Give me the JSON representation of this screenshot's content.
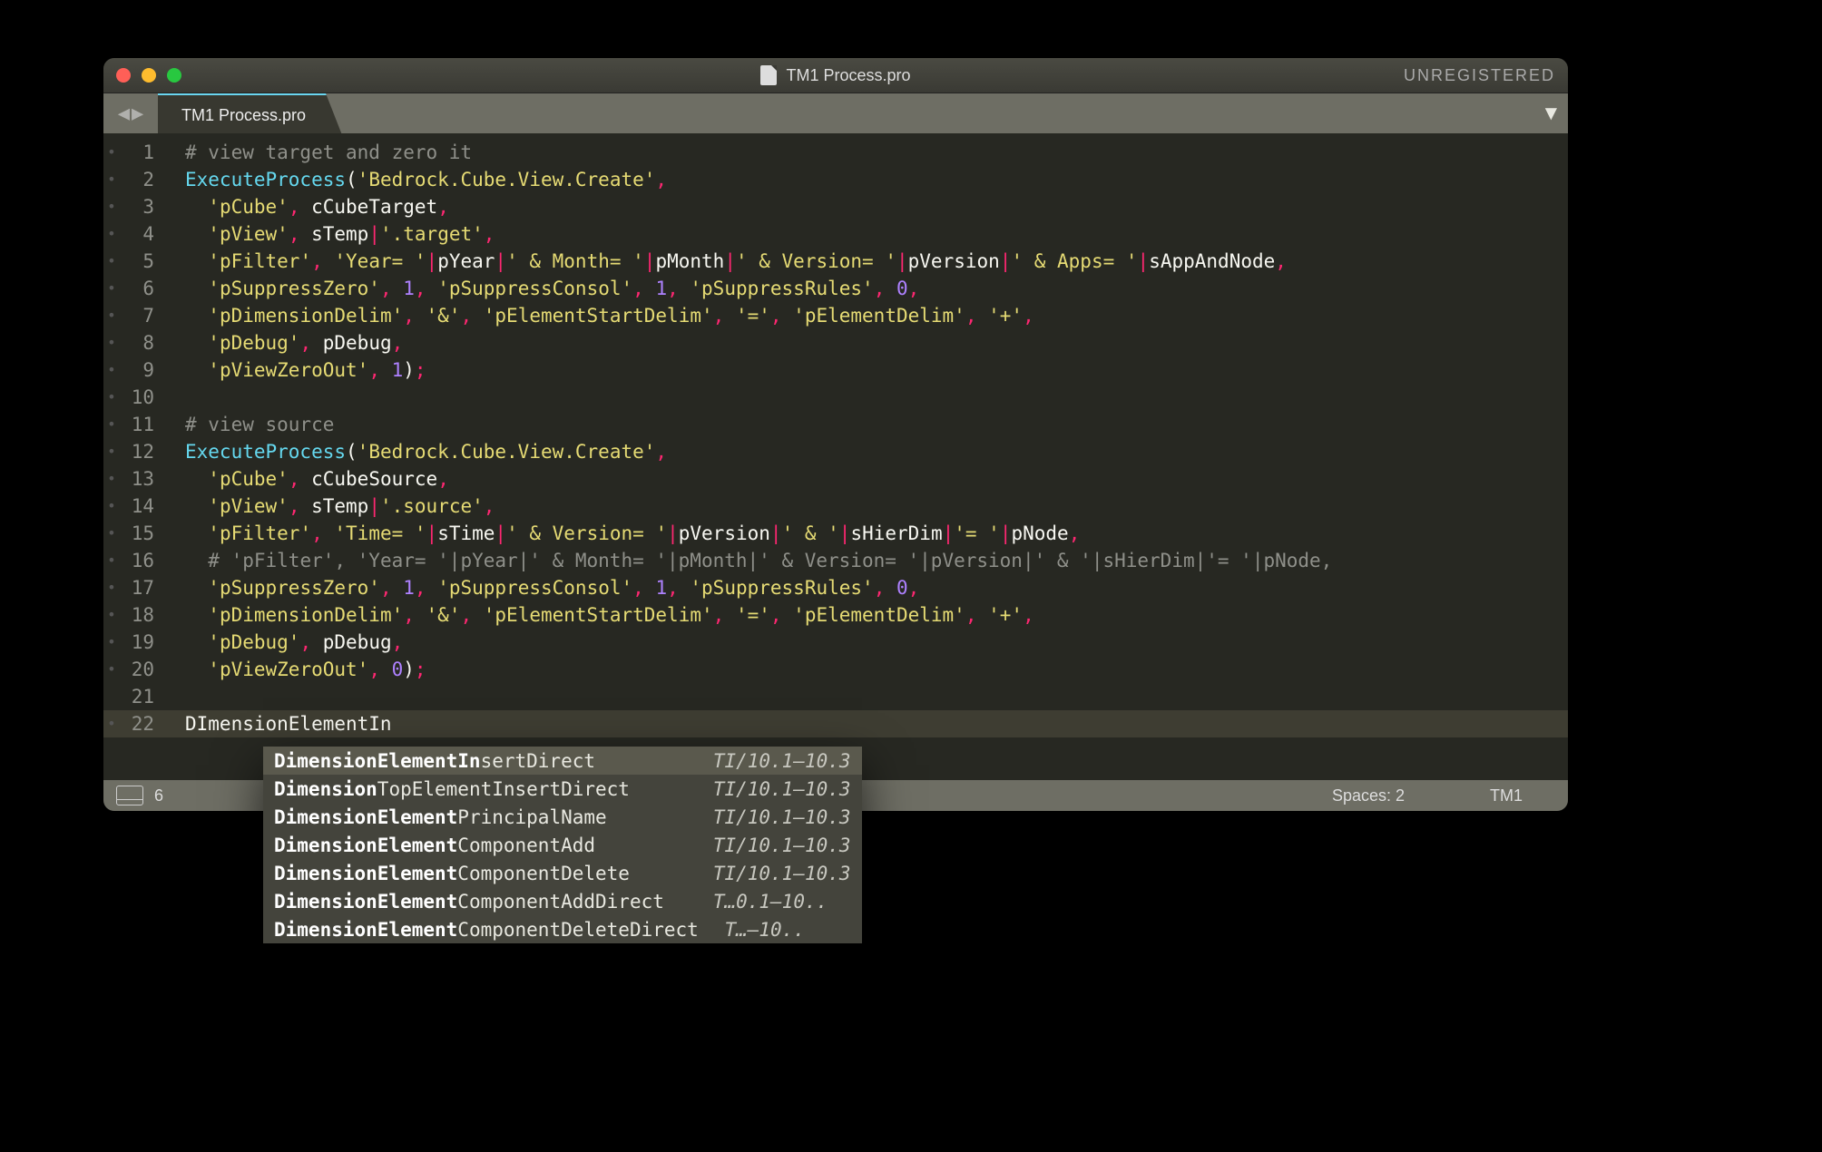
{
  "window": {
    "title": "TM1 Process.pro",
    "unregistered_label": "UNREGISTERED"
  },
  "tab": {
    "label": "TM1 Process.pro"
  },
  "status": {
    "spaces": "Spaces: 2",
    "lang": "TM1",
    "six": "6"
  },
  "autocomplete": {
    "typed": "DImensionElementIn",
    "items": [
      {
        "bold": "DimensionElementIn",
        "rest": "sertDirect",
        "cat": "TI/10.1–10.3"
      },
      {
        "bold": "Dimension",
        "rest": "TopElementInsertDirect",
        "cat": "TI/10.1–10.3"
      },
      {
        "bold": "DimensionElement",
        "rest": "PrincipalName",
        "cat": "TI/10.1–10.3"
      },
      {
        "bold": "DimensionElement",
        "rest": "ComponentAdd",
        "cat": "TI/10.1–10.3"
      },
      {
        "bold": "DimensionElement",
        "rest": "ComponentDelete",
        "cat": "TI/10.1–10.3"
      },
      {
        "bold": "DimensionElement",
        "rest": "ComponentAddDirect",
        "cat": "T…0.1–10.."
      },
      {
        "bold": "DimensionElement",
        "rest": "ComponentDeleteDirect",
        "cat": "T…–10.."
      }
    ]
  },
  "code": {
    "lines": [
      {
        "n": 1,
        "dot": true,
        "tokens": [
          [
            "comment",
            "# view target and zero it"
          ]
        ]
      },
      {
        "n": 2,
        "dot": true,
        "tokens": [
          [
            "func",
            "ExecuteProcess"
          ],
          [
            "plain",
            "("
          ],
          [
            "string",
            "'Bedrock.Cube.View.Create'"
          ],
          [
            "punc",
            ","
          ]
        ]
      },
      {
        "n": 3,
        "dot": true,
        "tokens": [
          [
            "plain",
            "  "
          ],
          [
            "string",
            "'pCube'"
          ],
          [
            "punc",
            ", "
          ],
          [
            "var",
            "cCubeTarget"
          ],
          [
            "punc",
            ","
          ]
        ]
      },
      {
        "n": 4,
        "dot": true,
        "tokens": [
          [
            "plain",
            "  "
          ],
          [
            "string",
            "'pView'"
          ],
          [
            "punc",
            ", "
          ],
          [
            "var",
            "sTemp"
          ],
          [
            "op",
            "|"
          ],
          [
            "string",
            "'.target'"
          ],
          [
            "punc",
            ","
          ]
        ]
      },
      {
        "n": 5,
        "dot": true,
        "tokens": [
          [
            "plain",
            "  "
          ],
          [
            "string",
            "'pFilter'"
          ],
          [
            "punc",
            ", "
          ],
          [
            "string",
            "'Year= '"
          ],
          [
            "op",
            "|"
          ],
          [
            "var",
            "pYear"
          ],
          [
            "op",
            "|"
          ],
          [
            "string",
            "' & Month= '"
          ],
          [
            "op",
            "|"
          ],
          [
            "var",
            "pMonth"
          ],
          [
            "op",
            "|"
          ],
          [
            "string",
            "' & Version= '"
          ],
          [
            "op",
            "|"
          ],
          [
            "var",
            "pVersion"
          ],
          [
            "op",
            "|"
          ],
          [
            "string",
            "' & Apps= '"
          ],
          [
            "op",
            "|"
          ],
          [
            "var",
            "sAppAndNode"
          ],
          [
            "punc",
            ","
          ]
        ]
      },
      {
        "n": 6,
        "dot": true,
        "tokens": [
          [
            "plain",
            "  "
          ],
          [
            "string",
            "'pSuppressZero'"
          ],
          [
            "punc",
            ", "
          ],
          [
            "num",
            "1"
          ],
          [
            "punc",
            ", "
          ],
          [
            "string",
            "'pSuppressConsol'"
          ],
          [
            "punc",
            ", "
          ],
          [
            "num",
            "1"
          ],
          [
            "punc",
            ", "
          ],
          [
            "string",
            "'pSuppressRules'"
          ],
          [
            "punc",
            ", "
          ],
          [
            "num",
            "0"
          ],
          [
            "punc",
            ","
          ]
        ]
      },
      {
        "n": 7,
        "dot": true,
        "tokens": [
          [
            "plain",
            "  "
          ],
          [
            "string",
            "'pDimensionDelim'"
          ],
          [
            "punc",
            ", "
          ],
          [
            "string",
            "'&'"
          ],
          [
            "punc",
            ", "
          ],
          [
            "string",
            "'pElementStartDelim'"
          ],
          [
            "punc",
            ", "
          ],
          [
            "string",
            "'='"
          ],
          [
            "punc",
            ", "
          ],
          [
            "string",
            "'pElementDelim'"
          ],
          [
            "punc",
            ", "
          ],
          [
            "string",
            "'+'"
          ],
          [
            "punc",
            ","
          ]
        ]
      },
      {
        "n": 8,
        "dot": true,
        "tokens": [
          [
            "plain",
            "  "
          ],
          [
            "string",
            "'pDebug'"
          ],
          [
            "punc",
            ", "
          ],
          [
            "var",
            "pDebug"
          ],
          [
            "punc",
            ","
          ]
        ]
      },
      {
        "n": 9,
        "dot": true,
        "tokens": [
          [
            "plain",
            "  "
          ],
          [
            "string",
            "'pViewZeroOut'"
          ],
          [
            "punc",
            ", "
          ],
          [
            "num",
            "1"
          ],
          [
            "plain",
            ")"
          ],
          [
            "punc",
            ";"
          ]
        ]
      },
      {
        "n": 10,
        "dot": true,
        "tokens": []
      },
      {
        "n": 11,
        "dot": true,
        "tokens": [
          [
            "comment",
            "# view source"
          ]
        ]
      },
      {
        "n": 12,
        "dot": true,
        "tokens": [
          [
            "func",
            "ExecuteProcess"
          ],
          [
            "plain",
            "("
          ],
          [
            "string",
            "'Bedrock.Cube.View.Create'"
          ],
          [
            "punc",
            ","
          ]
        ]
      },
      {
        "n": 13,
        "dot": true,
        "tokens": [
          [
            "plain",
            "  "
          ],
          [
            "string",
            "'pCube'"
          ],
          [
            "punc",
            ", "
          ],
          [
            "var",
            "cCubeSource"
          ],
          [
            "punc",
            ","
          ]
        ]
      },
      {
        "n": 14,
        "dot": true,
        "tokens": [
          [
            "plain",
            "  "
          ],
          [
            "string",
            "'pView'"
          ],
          [
            "punc",
            ", "
          ],
          [
            "var",
            "sTemp"
          ],
          [
            "op",
            "|"
          ],
          [
            "string",
            "'.source'"
          ],
          [
            "punc",
            ","
          ]
        ]
      },
      {
        "n": 15,
        "dot": true,
        "tokens": [
          [
            "plain",
            "  "
          ],
          [
            "string",
            "'pFilter'"
          ],
          [
            "punc",
            ", "
          ],
          [
            "string",
            "'Time= '"
          ],
          [
            "op",
            "|"
          ],
          [
            "var",
            "sTime"
          ],
          [
            "op",
            "|"
          ],
          [
            "string",
            "' & Version= '"
          ],
          [
            "op",
            "|"
          ],
          [
            "var",
            "pVersion"
          ],
          [
            "op",
            "|"
          ],
          [
            "string",
            "' & '"
          ],
          [
            "op",
            "|"
          ],
          [
            "var",
            "sHierDim"
          ],
          [
            "op",
            "|"
          ],
          [
            "string",
            "'= '"
          ],
          [
            "op",
            "|"
          ],
          [
            "var",
            "pNode"
          ],
          [
            "punc",
            ","
          ]
        ]
      },
      {
        "n": 16,
        "dot": true,
        "tokens": [
          [
            "plain",
            "  "
          ],
          [
            "comment",
            "# 'pFilter', 'Year= '|pYear|' & Month= '|pMonth|' & Version= '|pVersion|' & '|sHierDim|'= '|pNode,"
          ]
        ]
      },
      {
        "n": 17,
        "dot": true,
        "tokens": [
          [
            "plain",
            "  "
          ],
          [
            "string",
            "'pSuppressZero'"
          ],
          [
            "punc",
            ", "
          ],
          [
            "num",
            "1"
          ],
          [
            "punc",
            ", "
          ],
          [
            "string",
            "'pSuppressConsol'"
          ],
          [
            "punc",
            ", "
          ],
          [
            "num",
            "1"
          ],
          [
            "punc",
            ", "
          ],
          [
            "string",
            "'pSuppressRules'"
          ],
          [
            "punc",
            ", "
          ],
          [
            "num",
            "0"
          ],
          [
            "punc",
            ","
          ]
        ]
      },
      {
        "n": 18,
        "dot": true,
        "tokens": [
          [
            "plain",
            "  "
          ],
          [
            "string",
            "'pDimensionDelim'"
          ],
          [
            "punc",
            ", "
          ],
          [
            "string",
            "'&'"
          ],
          [
            "punc",
            ", "
          ],
          [
            "string",
            "'pElementStartDelim'"
          ],
          [
            "punc",
            ", "
          ],
          [
            "string",
            "'='"
          ],
          [
            "punc",
            ", "
          ],
          [
            "string",
            "'pElementDelim'"
          ],
          [
            "punc",
            ", "
          ],
          [
            "string",
            "'+'"
          ],
          [
            "punc",
            ","
          ]
        ]
      },
      {
        "n": 19,
        "dot": true,
        "tokens": [
          [
            "plain",
            "  "
          ],
          [
            "string",
            "'pDebug'"
          ],
          [
            "punc",
            ", "
          ],
          [
            "var",
            "pDebug"
          ],
          [
            "punc",
            ","
          ]
        ]
      },
      {
        "n": 20,
        "dot": true,
        "tokens": [
          [
            "plain",
            "  "
          ],
          [
            "string",
            "'pViewZeroOut'"
          ],
          [
            "punc",
            ", "
          ],
          [
            "num",
            "0"
          ],
          [
            "plain",
            ")"
          ],
          [
            "punc",
            ";"
          ]
        ]
      },
      {
        "n": 21,
        "dot": false,
        "tokens": []
      },
      {
        "n": 22,
        "dot": true,
        "tokens": [
          [
            "var",
            "DImensionElementIn"
          ]
        ]
      }
    ]
  }
}
